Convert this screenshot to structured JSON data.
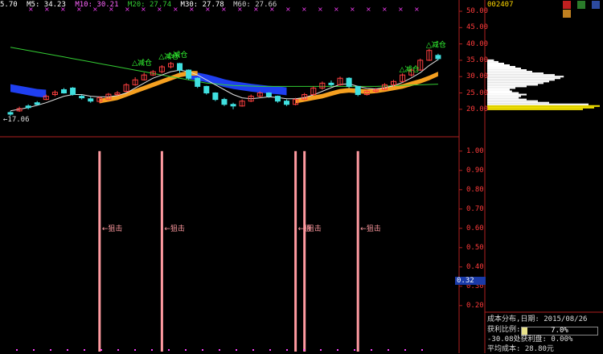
{
  "header": {
    "items": [
      {
        "label": "5.70",
        "color": "#ffffff"
      },
      {
        "label": "M5: 34.23",
        "color": "#ffffff"
      },
      {
        "label": "M10: 30.21",
        "color": "#ff66ff"
      },
      {
        "label": "M20: 27.74",
        "color": "#33cc33"
      },
      {
        "label": "M30: 27.78",
        "color": "#ffffff"
      },
      {
        "label": "M60: 27.66",
        "color": "#cccccc"
      }
    ]
  },
  "stock_code": "002407",
  "price_axis": [
    "50.00",
    "45.00",
    "40.00",
    "35.00",
    "30.00",
    "25.00",
    "20.00"
  ],
  "indicator_axis": [
    "1.00",
    "0.90",
    "0.80",
    "0.70",
    "0.60",
    "0.50",
    "0.40",
    "0.30",
    "0.20"
  ],
  "current_indicator_value": "0.32",
  "low_label": "17.06",
  "signal_labels": {
    "reduce": "减仓",
    "snipe": "←狙击",
    "snipe_short": "←狙",
    "snipe_cut": "狙击"
  },
  "cost_panel": {
    "title_line": "成本分布,日期:  2015/08/26",
    "profit_ratio_label": "获利比例:",
    "profit_ratio_value": "7.0%",
    "profit_ratio": 0.07,
    "profit_line": "-30.08处获利盘:  0.00%",
    "avg_cost_line": "平均成本:  28.80元"
  },
  "chart_data": {
    "type": "line",
    "price_ylim": [
      17,
      50
    ],
    "indicator_ylim": [
      0.17,
      1.02
    ],
    "candles": [
      {
        "o": 19.0,
        "c": 18.5,
        "h": 19.5,
        "l": 18.0
      },
      {
        "o": 19.5,
        "c": 20.2,
        "h": 20.8,
        "l": 19.2
      },
      {
        "o": 21.0,
        "c": 20.5,
        "h": 21.5,
        "l": 20.0
      },
      {
        "o": 22.0,
        "c": 21.5,
        "h": 22.5,
        "l": 21.2
      },
      {
        "o": 23.0,
        "c": 24.0,
        "h": 24.5,
        "l": 22.8
      },
      {
        "o": 24.5,
        "c": 25.2,
        "h": 25.8,
        "l": 24.0
      },
      {
        "o": 26.0,
        "c": 25.0,
        "h": 26.5,
        "l": 24.8
      },
      {
        "o": 26.5,
        "c": 24.5,
        "h": 26.8,
        "l": 24.2
      },
      {
        "o": 24.0,
        "c": 23.5,
        "h": 24.5,
        "l": 23.0
      },
      {
        "o": 23.2,
        "c": 22.5,
        "h": 23.8,
        "l": 22.0
      },
      {
        "o": 22.4,
        "c": 23.5,
        "h": 24.0,
        "l": 22.0
      },
      {
        "o": 23.0,
        "c": 24.6,
        "h": 25.0,
        "l": 22.8
      },
      {
        "o": 24.5,
        "c": 25.0,
        "h": 25.6,
        "l": 24.2
      },
      {
        "o": 25.5,
        "c": 27.5,
        "h": 28.0,
        "l": 25.2
      },
      {
        "o": 27.5,
        "c": 29.0,
        "h": 29.8,
        "l": 27.2
      },
      {
        "o": 29.0,
        "c": 30.5,
        "h": 31.2,
        "l": 28.8
      },
      {
        "o": 30.5,
        "c": 31.5,
        "h": 32.0,
        "l": 30.2
      },
      {
        "o": 31.5,
        "c": 33.0,
        "h": 33.5,
        "l": 31.0
      },
      {
        "o": 33.0,
        "c": 34.0,
        "h": 34.5,
        "l": 32.5
      },
      {
        "o": 34.0,
        "c": 32.0,
        "h": 34.2,
        "l": 31.0
      },
      {
        "o": 32.0,
        "c": 29.5,
        "h": 32.2,
        "l": 29.0
      },
      {
        "o": 29.5,
        "c": 27.0,
        "h": 29.8,
        "l": 26.5
      },
      {
        "o": 27.0,
        "c": 25.0,
        "h": 27.2,
        "l": 24.5
      },
      {
        "o": 25.0,
        "c": 23.0,
        "h": 25.2,
        "l": 22.5
      },
      {
        "o": 23.0,
        "c": 21.5,
        "h": 23.5,
        "l": 21.0
      },
      {
        "o": 21.5,
        "c": 21.0,
        "h": 22.0,
        "l": 20.0
      },
      {
        "o": 21.0,
        "c": 22.5,
        "h": 23.0,
        "l": 20.8
      },
      {
        "o": 22.5,
        "c": 24.0,
        "h": 24.5,
        "l": 22.2
      },
      {
        "o": 24.0,
        "c": 25.0,
        "h": 25.5,
        "l": 23.5
      },
      {
        "o": 25.0,
        "c": 24.0,
        "h": 25.2,
        "l": 23.5
      },
      {
        "o": 24.0,
        "c": 22.5,
        "h": 24.2,
        "l": 22.0
      },
      {
        "o": 22.5,
        "c": 21.5,
        "h": 23.0,
        "l": 21.0
      },
      {
        "o": 21.5,
        "c": 23.0,
        "h": 23.5,
        "l": 21.2
      },
      {
        "o": 23.0,
        "c": 24.5,
        "h": 25.0,
        "l": 22.8
      },
      {
        "o": 24.5,
        "c": 26.5,
        "h": 27.0,
        "l": 24.2
      },
      {
        "o": 26.5,
        "c": 28.0,
        "h": 28.5,
        "l": 26.0
      },
      {
        "o": 28.0,
        "c": 27.5,
        "h": 28.8,
        "l": 27.0
      },
      {
        "o": 27.5,
        "c": 29.5,
        "h": 30.0,
        "l": 27.2
      },
      {
        "o": 29.5,
        "c": 27.0,
        "h": 29.8,
        "l": 26.5
      },
      {
        "o": 27.0,
        "c": 24.5,
        "h": 27.2,
        "l": 24.0
      },
      {
        "o": 24.5,
        "c": 25.5,
        "h": 26.0,
        "l": 24.2
      },
      {
        "o": 25.5,
        "c": 26.0,
        "h": 26.5,
        "l": 25.0
      },
      {
        "o": 26.0,
        "c": 27.5,
        "h": 28.0,
        "l": 25.8
      },
      {
        "o": 27.5,
        "c": 28.5,
        "h": 29.0,
        "l": 27.0
      },
      {
        "o": 28.5,
        "c": 30.5,
        "h": 31.0,
        "l": 28.2
      },
      {
        "o": 30.5,
        "c": 32.0,
        "h": 32.5,
        "l": 30.0
      },
      {
        "o": 32.0,
        "c": 35.0,
        "h": 35.5,
        "l": 31.8
      },
      {
        "o": 35.0,
        "c": 38.0,
        "h": 38.5,
        "l": 34.8
      },
      {
        "o": 36.5,
        "c": 35.5,
        "h": 37.0,
        "l": 35.0
      }
    ],
    "ma_green": [
      39,
      38.5,
      38,
      37.5,
      37,
      36.5,
      36,
      35.5,
      35,
      34.5,
      34,
      33.5,
      33,
      32.5,
      32,
      31.5,
      31,
      30.5,
      30,
      29.5,
      29,
      28.5,
      28,
      27.8,
      27.5,
      27.3,
      27.2,
      27.1,
      27,
      27,
      27,
      27,
      27,
      27,
      27,
      27,
      27,
      27,
      27,
      27,
      27,
      27,
      27.1,
      27.2,
      27.3,
      27.4,
      27.5,
      27.6,
      27.7
    ],
    "ma_white": [
      19.5,
      20,
      20.5,
      21.2,
      22,
      23,
      24,
      24.5,
      24.5,
      24,
      23.8,
      23.8,
      24.2,
      25,
      26.5,
      28,
      29.5,
      30.5,
      31.5,
      32,
      31.5,
      30.5,
      29,
      27.5,
      26,
      24.5,
      23.5,
      23.2,
      23.5,
      23.8,
      23.6,
      23.2,
      23.2,
      23.6,
      24.4,
      25.5,
      26.6,
      27.6,
      27.8,
      27,
      26.4,
      26.2,
      26.6,
      27.2,
      28.2,
      29.6,
      31.2,
      33.4,
      35.2
    ],
    "band_orange": [
      null,
      null,
      null,
      null,
      null,
      null,
      null,
      null,
      null,
      null,
      22.5,
      23,
      23.5,
      24.5,
      25.5,
      26.5,
      27.5,
      28.5,
      29.5,
      30.5,
      31,
      31,
      null,
      null,
      null,
      null,
      null,
      null,
      null,
      null,
      null,
      null,
      22.5,
      23,
      23.5,
      24,
      24.8,
      25.5,
      25.8,
      25.6,
      25.4,
      25.6,
      26,
      26.5,
      27,
      27.8,
      28.6,
      29.6,
      30.8
    ],
    "band_blue": [
      26.5,
      26,
      25.5,
      25,
      24.8,
      null,
      null,
      null,
      null,
      null,
      null,
      null,
      null,
      null,
      null,
      null,
      null,
      null,
      null,
      null,
      30.5,
      30,
      29.5,
      28.8,
      28,
      27.4,
      27,
      26.6,
      26.3,
      26,
      25.8,
      25.5,
      null,
      null,
      null,
      null,
      null,
      null,
      null,
      null,
      null,
      null,
      null,
      null,
      null,
      null,
      null,
      null,
      null
    ],
    "signals_indicator": [
      {
        "bar": 10,
        "value": 1.0
      },
      {
        "bar": 17,
        "value": 1.0
      },
      {
        "bar": 32,
        "value": 1.0
      },
      {
        "bar": 33,
        "value": 1.0
      },
      {
        "bar": 39,
        "value": 1.0
      }
    ],
    "reduce_signals": [
      {
        "bar": 14,
        "price": 33
      },
      {
        "bar": 17,
        "price": 35
      },
      {
        "bar": 18,
        "price": 35.5
      },
      {
        "bar": 44,
        "price": 31
      },
      {
        "bar": 47,
        "price": 38.5
      }
    ],
    "cost_distribution": [
      {
        "p": 20,
        "w": 0.85,
        "c": "#f5e400"
      },
      {
        "p": 20.5,
        "w": 0.95,
        "c": "#f5e400"
      },
      {
        "p": 21,
        "w": 1.0,
        "c": "#f5e400"
      },
      {
        "p": 21.5,
        "w": 0.9,
        "c": "#ffffff"
      },
      {
        "p": 22,
        "w": 0.55,
        "c": "#ffffff"
      },
      {
        "p": 22.5,
        "w": 0.45,
        "c": "#ffffff"
      },
      {
        "p": 23,
        "w": 0.35,
        "c": "#ffffff"
      },
      {
        "p": 23.5,
        "w": 0.28,
        "c": "#ffffff"
      },
      {
        "p": 24,
        "w": 0.3,
        "c": "#ffffff"
      },
      {
        "p": 24.5,
        "w": 0.35,
        "c": "#ffffff"
      },
      {
        "p": 25,
        "w": 0.28,
        "c": "#ffffff"
      },
      {
        "p": 25.5,
        "w": 0.22,
        "c": "#ffffff"
      },
      {
        "p": 26,
        "w": 0.2,
        "c": "#ffffff"
      },
      {
        "p": 26.5,
        "w": 0.25,
        "c": "#ffffff"
      },
      {
        "p": 27,
        "w": 0.35,
        "c": "#ffffff"
      },
      {
        "p": 27.5,
        "w": 0.45,
        "c": "#ffffff"
      },
      {
        "p": 28,
        "w": 0.5,
        "c": "#ffffff"
      },
      {
        "p": 28.5,
        "w": 0.55,
        "c": "#ffffff"
      },
      {
        "p": 29,
        "w": 0.6,
        "c": "#ffffff"
      },
      {
        "p": 29.5,
        "w": 0.65,
        "c": "#ffffff"
      },
      {
        "p": 30,
        "w": 0.68,
        "c": "#ffffff"
      },
      {
        "p": 30.5,
        "w": 0.6,
        "c": "#ffffff"
      },
      {
        "p": 31,
        "w": 0.5,
        "c": "#ffffff"
      },
      {
        "p": 31.5,
        "w": 0.4,
        "c": "#ffffff"
      },
      {
        "p": 32,
        "w": 0.35,
        "c": "#ffffff"
      },
      {
        "p": 32.5,
        "w": 0.3,
        "c": "#ffffff"
      },
      {
        "p": 33,
        "w": 0.25,
        "c": "#ffffff"
      },
      {
        "p": 33.5,
        "w": 0.2,
        "c": "#ffffff"
      },
      {
        "p": 34,
        "w": 0.15,
        "c": "#ffffff"
      },
      {
        "p": 34.5,
        "w": 0.1,
        "c": "#ffffff"
      },
      {
        "p": 35,
        "w": 0.06,
        "c": "#ffffff"
      }
    ]
  }
}
